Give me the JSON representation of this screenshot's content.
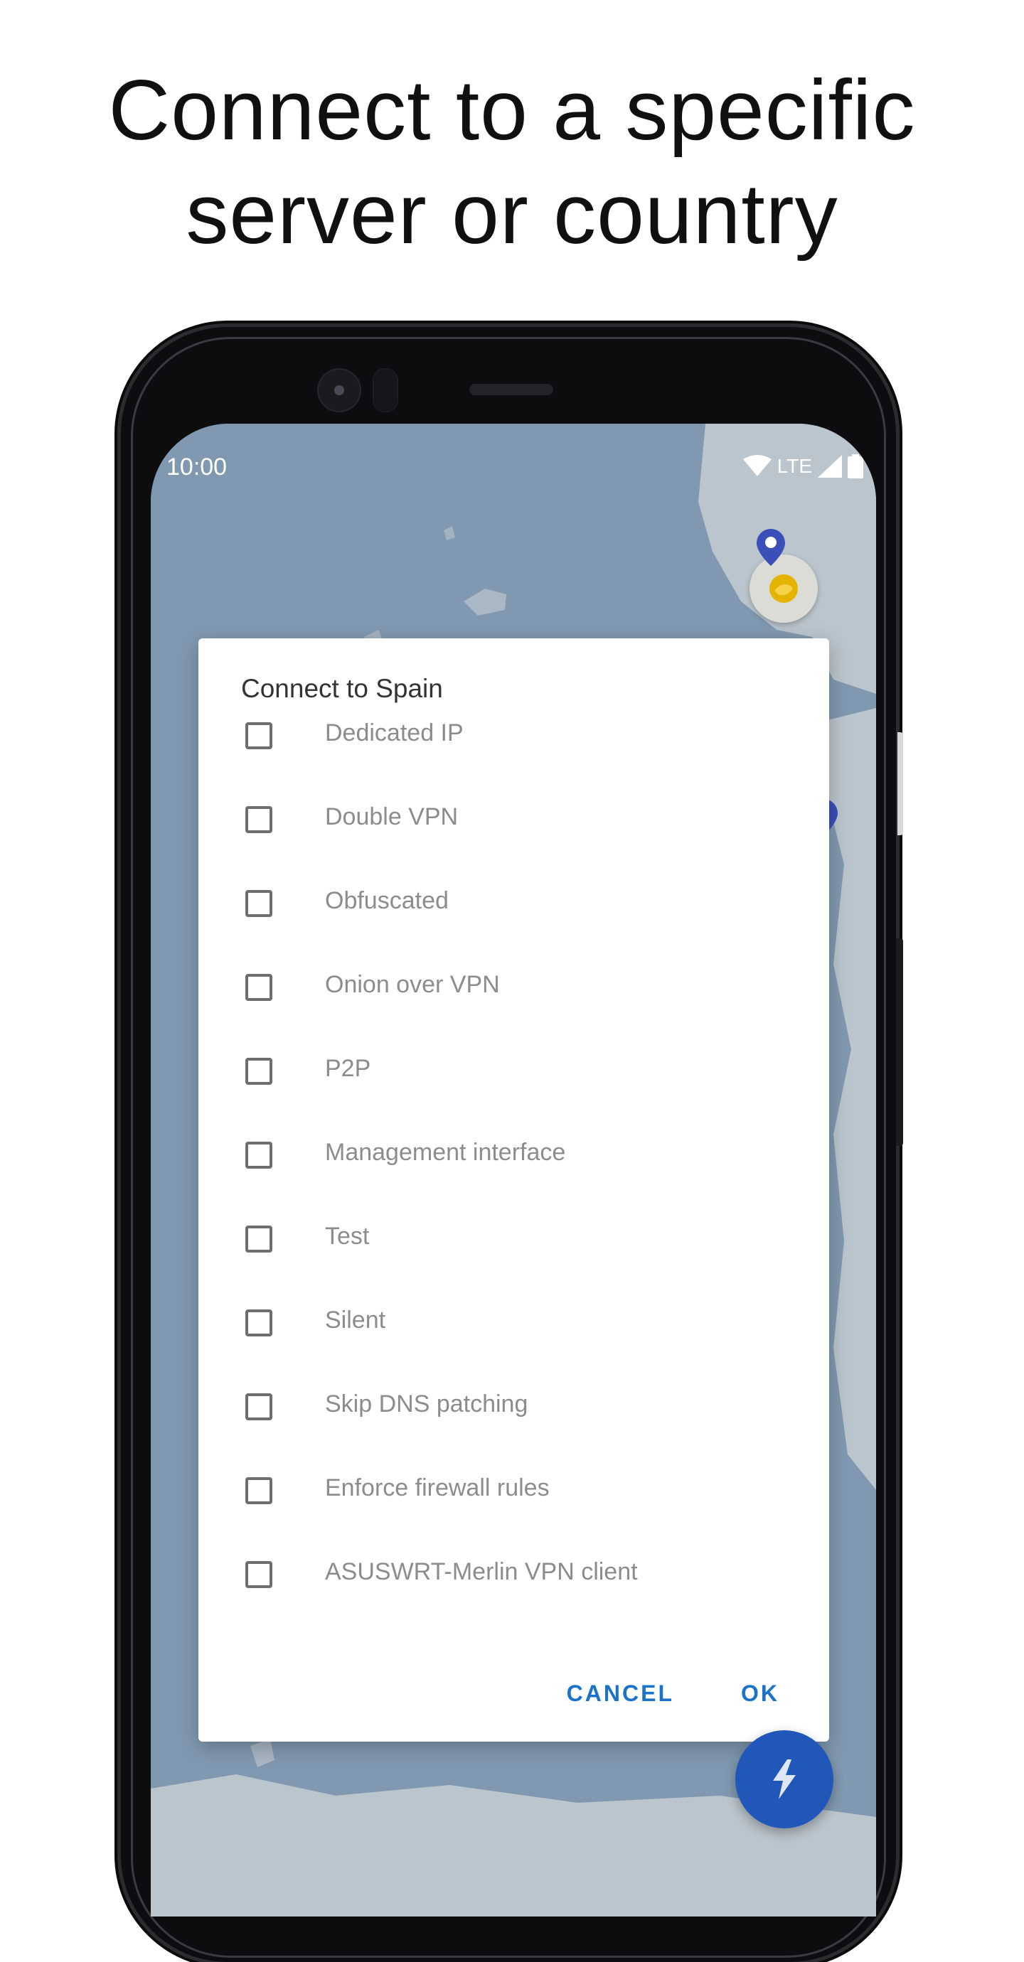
{
  "headline": {
    "line1": "Connect to a specific",
    "line2": "server or country"
  },
  "status_bar": {
    "time": "10:00",
    "network": "LTE",
    "icons": [
      "wifi-icon",
      "cell-signal-icon",
      "battery-icon"
    ]
  },
  "dialog": {
    "title": "Connect to Spain",
    "options": [
      {
        "label": "Dedicated IP",
        "checked": false
      },
      {
        "label": "Double VPN",
        "checked": false
      },
      {
        "label": "Obfuscated",
        "checked": false
      },
      {
        "label": "Onion over VPN",
        "checked": false
      },
      {
        "label": "P2P",
        "checked": false
      },
      {
        "label": "Management interface",
        "checked": false
      },
      {
        "label": "Test",
        "checked": false
      },
      {
        "label": "Silent",
        "checked": false
      },
      {
        "label": "Skip DNS patching",
        "checked": false
      },
      {
        "label": "Enforce firewall rules",
        "checked": false
      },
      {
        "label": "ASUSWRT-Merlin VPN client",
        "checked": false
      }
    ],
    "cancel_label": "CANCEL",
    "ok_label": "OK"
  },
  "map": {
    "markers": [
      "server-pin-icon",
      "server-pin-icon",
      "server-pin-icon",
      "country-marker-icon"
    ],
    "fab_icon": "quick-connect-bolt-icon"
  },
  "colors": {
    "accent": "#1a73c9",
    "fab": "#2157b8",
    "pin": "#3a4fb8",
    "map_water": "#8199b0",
    "map_land": "#c6ccd2"
  }
}
